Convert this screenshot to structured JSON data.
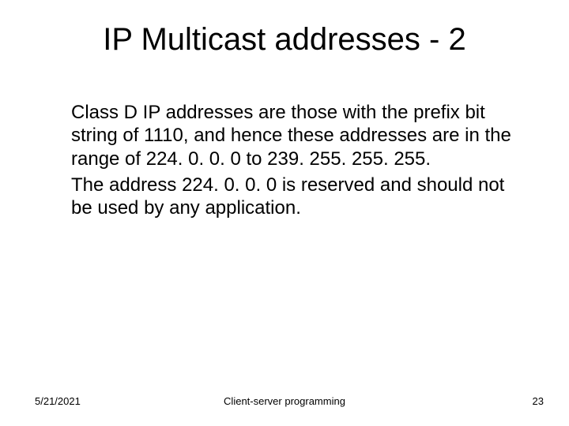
{
  "title": "IP Multicast addresses - 2",
  "paragraphs": [
    "Class D IP addresses are those with the prefix bit string of 1110, and hence these addresses are in the range of 224. 0. 0. 0  to 239. 255. 255. 255.",
    "The address 224. 0. 0. 0 is reserved and should not be used by any application."
  ],
  "footer": {
    "date": "5/21/2021",
    "center": "Client-server programming",
    "page": "23"
  }
}
